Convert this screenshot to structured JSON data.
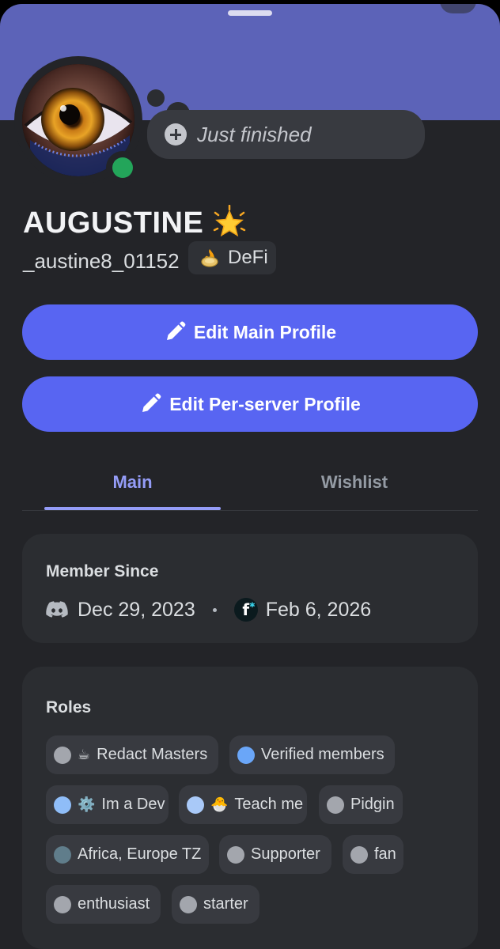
{
  "status": {
    "text": "Just finished"
  },
  "profile": {
    "display_name": "AUGUSTINE",
    "username": "_austine8_01152",
    "tag": "DeFi",
    "online": true
  },
  "actions": {
    "edit_main": "Edit Main Profile",
    "edit_server": "Edit Per-server Profile"
  },
  "tabs": {
    "main": "Main",
    "wishlist": "Wishlist",
    "active": "Main"
  },
  "member_since": {
    "title": "Member Since",
    "discord_date": "Dec 29, 2023",
    "server_date": "Feb 6, 2026"
  },
  "roles": {
    "title": "Roles",
    "items": [
      {
        "label": "Redact Masters",
        "emoji": "☕",
        "color": "#a3a6ad"
      },
      {
        "label": "Verified members",
        "emoji": "",
        "color": "#6aa6f8"
      },
      {
        "label": "Im a Dev",
        "emoji": "⚙️",
        "color": "#8fbdf8"
      },
      {
        "label": "Teach me",
        "emoji": "🐣",
        "color": "#a9c9f8"
      },
      {
        "label": "Pidgin",
        "emoji": "",
        "color": "#a3a6ad"
      },
      {
        "label": "Africa, Europe TZ",
        "emoji": "",
        "color": "#607d8b"
      },
      {
        "label": "Supporter",
        "emoji": "",
        "color": "#a3a6ad"
      },
      {
        "label": "fan",
        "emoji": "",
        "color": "#a3a6ad"
      },
      {
        "label": "enthusiast",
        "emoji": "",
        "color": "#a3a6ad"
      },
      {
        "label": "starter",
        "emoji": "",
        "color": "#a3a6ad"
      }
    ]
  },
  "colors": {
    "banner": "#5c63b8",
    "background": "#232428",
    "card": "#2b2d31",
    "button": "#5865f2",
    "accent_tab": "#949cf7",
    "online": "#23a55a"
  },
  "icons": {
    "add_status": "plus-circle-icon",
    "name_badge": "glowing-star-icon",
    "tag_badge": "fire-coin-icon",
    "edit": "pencil-icon",
    "discord": "discord-logo-icon",
    "server": "server-f-icon"
  }
}
